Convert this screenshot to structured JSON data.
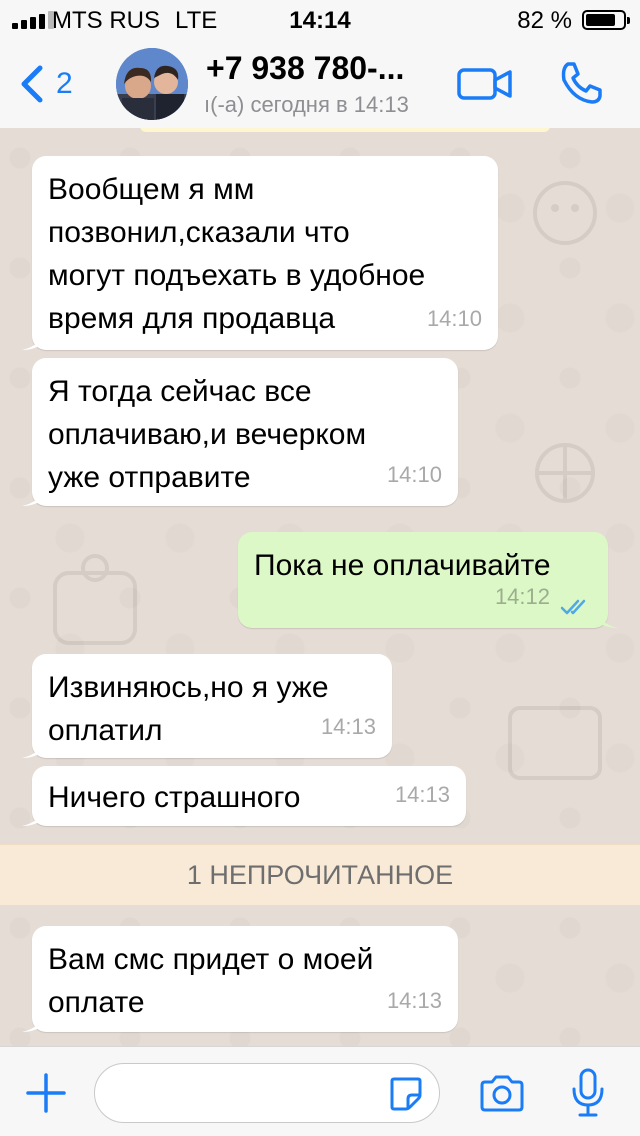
{
  "status_bar": {
    "carrier": "MTS RUS",
    "network": "LTE",
    "time": "14:14",
    "battery_percent": "82 %",
    "battery_level": 0.82
  },
  "header": {
    "back_count": "2",
    "contact_name": "+7 938 780-...",
    "contact_status": "ı(-а) сегодня в 14:13"
  },
  "messages": [
    {
      "direction": "in",
      "text": "Вообщем я мм\nпозвонил,сказали что\nмогут подъехать в удобное\nвремя для продавца",
      "time": "14:10"
    },
    {
      "direction": "in",
      "text": "Я тогда сейчас все\nоплачиваю,и вечерком\nуже отправите",
      "time": "14:10"
    },
    {
      "direction": "out",
      "text": "Пока не оплачивайте",
      "time": "14:12",
      "read": true
    },
    {
      "direction": "in",
      "text": "Извиняюсь,но я уже\nоплатил",
      "time": "14:13"
    },
    {
      "direction": "in",
      "text": "Ничего страшного",
      "time": "14:13"
    },
    {
      "direction": "in",
      "text": "Вам смс придет о моей\nоплате",
      "time": "14:13"
    }
  ],
  "unread_banner": "1 НЕПРОЧИТАННОЕ",
  "input": {
    "value": "",
    "placeholder": ""
  },
  "colors": {
    "accent": "#1a7cf6",
    "incoming_bubble": "#ffffff",
    "outgoing_bubble": "#dcf8c6",
    "chat_background": "#e5ddd5",
    "read_ticks": "#4fa9e8",
    "unread_banner": "#f9ead8"
  },
  "icons": [
    "signal-icon",
    "battery-icon",
    "back-chevron-icon",
    "video-camera-icon",
    "phone-icon",
    "plus-icon",
    "sticker-icon",
    "camera-icon",
    "microphone-icon",
    "double-check-icon"
  ]
}
